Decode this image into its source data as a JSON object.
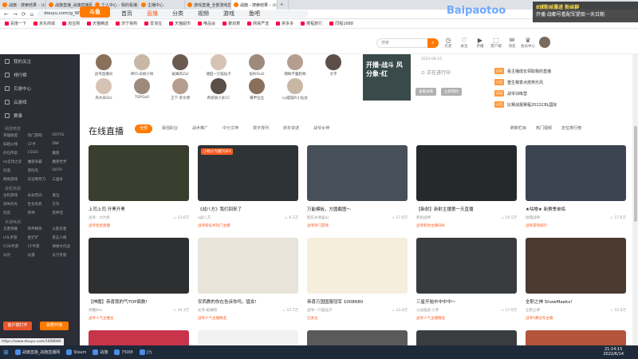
{
  "browser": {
    "tabs": [
      "战旗 - 搜索结果 - 斗鱼直播",
      "战旗直播_战旗直播网",
      "个人中心 - 我的看播 - 斗鱼",
      "主播中心",
      "游戏直播_全部游戏直播_斗鱼",
      "战旗 - 搜索结果 - 斗鱼直播",
      "+"
    ],
    "url": "douyu.com/g_WYZY",
    "bookmarks": [
      "百度一下",
      "京东商城",
      "淘宝网",
      "天猫精选",
      "苏宁易购",
      "爱淘宝",
      "天猫超市",
      "唯品会",
      "聚划算",
      "网易严选",
      "拼多多",
      "携程旅行",
      "同程1688"
    ]
  },
  "header": {
    "logo": "斗鱼",
    "nav": [
      "首页",
      "直播",
      "分类",
      "视频",
      "游戏",
      "鱼吧"
    ],
    "search_placeholder": "搜索",
    "icons": [
      {
        "label": "历史",
        "icon": "history-icon"
      },
      {
        "label": "关注",
        "icon": "follow-icon"
      },
      {
        "label": "开播",
        "icon": "broadcast-icon"
      },
      {
        "label": "客户端",
        "icon": "client-icon"
      },
      {
        "label": "消息",
        "icon": "message-icon"
      },
      {
        "label": "会员中心",
        "icon": "vip-icon"
      }
    ]
  },
  "sidebar": {
    "items": [
      "我的关注",
      "排行榜",
      "贝游中心",
      "云游戏",
      "赛事"
    ],
    "sections": [
      {
        "title": "网游竞技",
        "games": [
          "英雄联盟",
          "热门游戏",
          "DOTA2",
          "穿越火线",
          "CF手",
          "DNF",
          "炉石传说",
          "CSGO",
          "魔兽",
          "lol云顶之弈",
          "魔兽争霸",
          "魔兽世界",
          "问道",
          "冒险岛",
          "DOTA",
          "网易游戏",
          "天涯明月刀",
          "三国杀"
        ]
      },
      {
        "title": "单机热游",
        "games": [
          "主机游戏",
          "永劫无间",
          "鬼泣",
          "消失的光",
          "生化危机",
          "方舟",
          "饥荒",
          "原神",
          "黑神话"
        ]
      },
      {
        "title": "手游休闲",
        "games": [
          "王者荣耀",
          "和平精英",
          "火影忍者",
          "LOL手游",
          "金铲铲",
          "第五人格",
          "COD手游",
          "CF手游",
          "球球大作战",
          "派对",
          "光遇",
          "天刀手游"
        ]
      }
    ],
    "btn_client": "客户端打开",
    "btn_live": "我要开播"
  },
  "streamers_row1": [
    "战爷直播间",
    "神凹·白格小将",
    "斑斓风Zzz",
    "捕田一只猫仙子",
    "佑岭OuO",
    "朝鲜不露脸啊",
    "文字"
  ],
  "streamers_row2": [
    "风水命Zzz",
    "TOPGo0",
    "王下·李文博",
    "希丽丽小女CC",
    "番甲豆丝",
    "cy喵喵叭小仙女"
  ],
  "promo": {
    "text": "开播·战斗 风分象·红"
  },
  "reminder": {
    "text": "正在进行中",
    "btn1": "查看详情",
    "btn2": "立即预约",
    "date": "2022-06-15"
  },
  "news": [
    {
      "tag": "活动",
      "text": "看主播成长领取我的直播"
    },
    {
      "tag": "公告",
      "text": "重生赛季点燃男乐风"
    },
    {
      "tag": "活动",
      "text": "战爷训练营"
    },
    {
      "tag": "公告",
      "text": "比赛战报赛程2022CBL国际"
    }
  ],
  "live": {
    "title": "在线直播",
    "chips": [
      "全部",
      "最强职业",
      "战术推广",
      "中分文神",
      "数字排列",
      "新年讲述",
      "战爷女神"
    ],
    "right_links": [
      "刷新栏目",
      "热门视频",
      "定位排行榜"
    ]
  },
  "cards": [
    {
      "title": "上司上司 开黑开黑",
      "user": "战爷 · 力力拆",
      "views": "23.6万",
      "badge": "战爷星星直播",
      "tag": "",
      "color": "#3a3e2e"
    },
    {
      "title": "《战八方》我们回来了",
      "user": "a战八方",
      "views": "6.2万",
      "badge": "战爷新技术热门主播",
      "tag": "小财人气播TOP3",
      "color": "#2e3436"
    },
    {
      "title": "万能模板，方圆截图～",
      "user": "配乐冰清画山",
      "views": "17.6万",
      "badge": "战爷热门游戏",
      "tag": "",
      "color": "#475058"
    },
    {
      "title": "【新射】新射主播第一天直播",
      "user": "新射战神",
      "views": "16.5万",
      "badge": "战爷新射主播SBK",
      "tag": "",
      "color": "#26282a"
    },
    {
      "title": "★咕噜★ 新赛季单练",
      "user": "咕噜战神",
      "views": "17.6万",
      "badge": "战爷游戏排行",
      "tag": "",
      "color": "#3b4450"
    },
    {
      "title": "【神魔】恭喜我的气TOP面数!",
      "user": "神魔Ben",
      "views": "19.3万",
      "badge": "战爷人气主播主",
      "tag": "",
      "color": "#2d2f30"
    },
    {
      "title": "安西教的你在告诉你吗，猛女!",
      "user": "龙爷·斑斓网",
      "views": "15.7万",
      "badge": "战爷人气主播精选",
      "tag": "",
      "color": "#e9e4da"
    },
    {
      "title": "恭喜万国国服冠军 1008680",
      "user": "战爷一只猫仙子",
      "views": "13.4万",
      "badge": "已关注",
      "tag": "",
      "color": "#f6eedc"
    },
    {
      "title": "三星开始中中中中～",
      "user": "斗战威武·小乔",
      "views": "17.9万",
      "badge": "战爷人气主播精选",
      "tag": "",
      "color": "#383c3e"
    },
    {
      "title": "全职之神 ShowMaeks!",
      "user": "全职之神",
      "views": "55.6万",
      "badge": "战爷S赛冠军主播",
      "tag": "",
      "color": "#4a3a30"
    }
  ],
  "overlay": {
    "watermark_top": "8球粉丝雅进 粉丝群",
    "watermark_bottom": "开播·战都号看配军提取一天日期",
    "baipao": "Baipaotoo"
  },
  "statusbar_url": "https://www.douyu.com/1008680",
  "taskbar": {
    "items": [
      "战旗直播_战旗直播网",
      "Steam",
      "战旗",
      "7500t",
      "[九"
    ],
    "time": "21:14:15",
    "date": "2022/6/14"
  }
}
